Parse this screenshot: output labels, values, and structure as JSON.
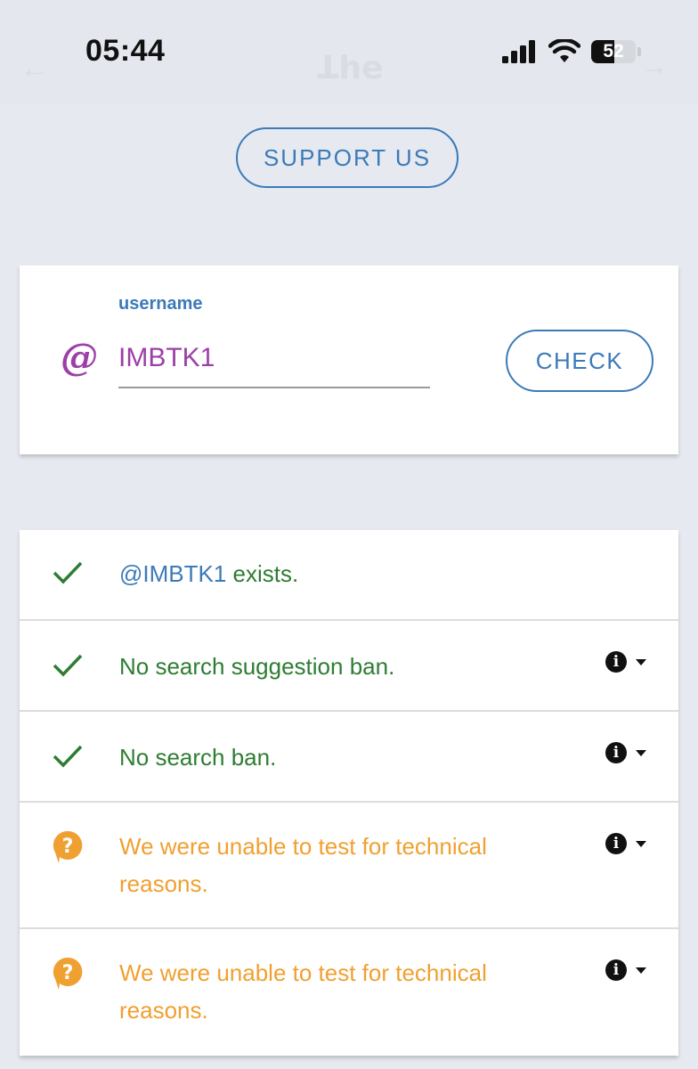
{
  "status_bar": {
    "time": "05:44",
    "battery_level": "52",
    "battery_fraction": 0.52
  },
  "background_header": {
    "title": "ꓕhe",
    "back_glyph": "←",
    "arrow_glyph": "→"
  },
  "support_button": {
    "label": "SUPPORT US"
  },
  "username_form": {
    "label": "username",
    "prefix": "@",
    "value": "IMBTK1",
    "check_label": "CHECK"
  },
  "results": [
    {
      "status": "ok",
      "icon": "check-icon",
      "handle": "@IMBTK1",
      "message": " exists.",
      "has_actions": false
    },
    {
      "status": "ok",
      "icon": "check-icon",
      "message": "No search suggestion ban.",
      "has_actions": true
    },
    {
      "status": "ok",
      "icon": "check-icon",
      "message": "No search ban.",
      "has_actions": true
    },
    {
      "status": "unknown",
      "icon": "question-bubble-icon",
      "message": "We were unable to test for technical reasons.",
      "has_actions": true
    },
    {
      "status": "unknown",
      "icon": "question-bubble-icon",
      "message": "We were unable to test for technical reasons.",
      "has_actions": true
    }
  ],
  "colors": {
    "accent_blue": "#3c7ab8",
    "success_green": "#2e7d32",
    "warning_orange": "#f0a030",
    "username_purple": "#9c3fa8",
    "background": "#e6eaf0"
  }
}
